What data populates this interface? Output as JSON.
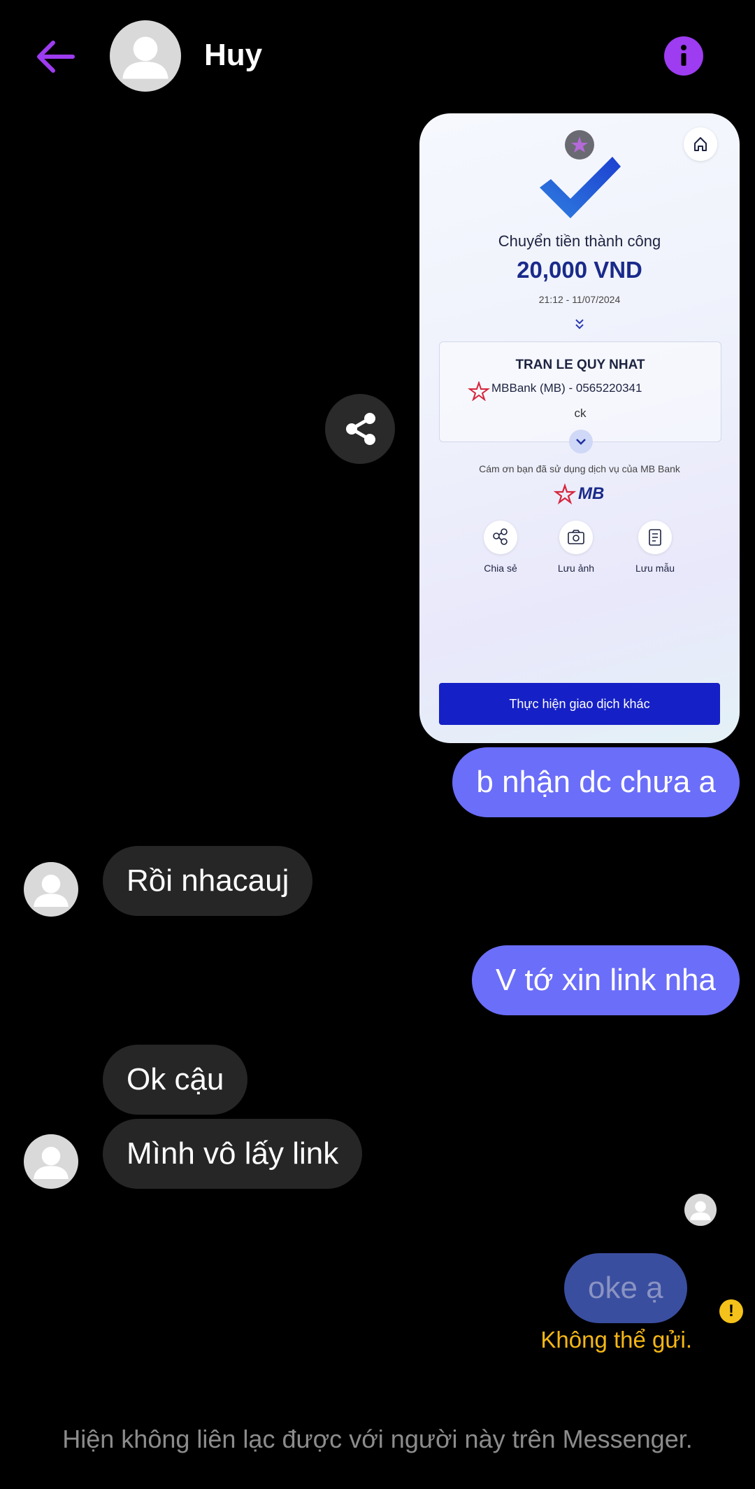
{
  "header": {
    "contact_name": "Huy"
  },
  "receipt": {
    "title": "Chuyển tiền thành công",
    "amount": "20,000 VND",
    "datetime": "21:12 - 11/07/2024",
    "recipient_name": "TRAN LE QUY NHAT",
    "bank_account": "MBBank (MB) - 0565220341",
    "note": "ck",
    "thanks": "Cám ơn bạn đã sử dụng dịch vụ của MB Bank",
    "logo_text": "MB",
    "actions": [
      "Chia sẻ",
      "Lưu ảnh",
      "Lưu mẫu"
    ],
    "button_label": "Thực hiện giao dịch khác"
  },
  "messages": [
    {
      "from": "me",
      "text": "b nhận dc chưa a"
    },
    {
      "from": "them",
      "text": "Rồi nhacauj"
    },
    {
      "from": "me",
      "text": "V tớ xin link nha"
    },
    {
      "from": "them",
      "text": "Ok cậu"
    },
    {
      "from": "them",
      "text": "Mình vô lấy link"
    },
    {
      "from": "me",
      "text": "oke ạ"
    }
  ],
  "status": {
    "failed_text": "Không thể gửi.",
    "warning_glyph": "!"
  },
  "footer": {
    "notice": "Hiện không liên lạc được với người này trên Messenger."
  },
  "colors": {
    "accent": "#9d3cf0",
    "outgoing": "#6b6ef9",
    "incoming": "#262626",
    "failed": "#f5b716"
  },
  "icons": [
    "back-arrow-icon",
    "info-icon",
    "share-icon",
    "home-icon",
    "checkmark-icon",
    "chevron-double-down-icon",
    "chevron-down-icon",
    "mb-star-icon",
    "share-nodes-icon",
    "camera-icon",
    "document-icon",
    "warning-icon"
  ]
}
